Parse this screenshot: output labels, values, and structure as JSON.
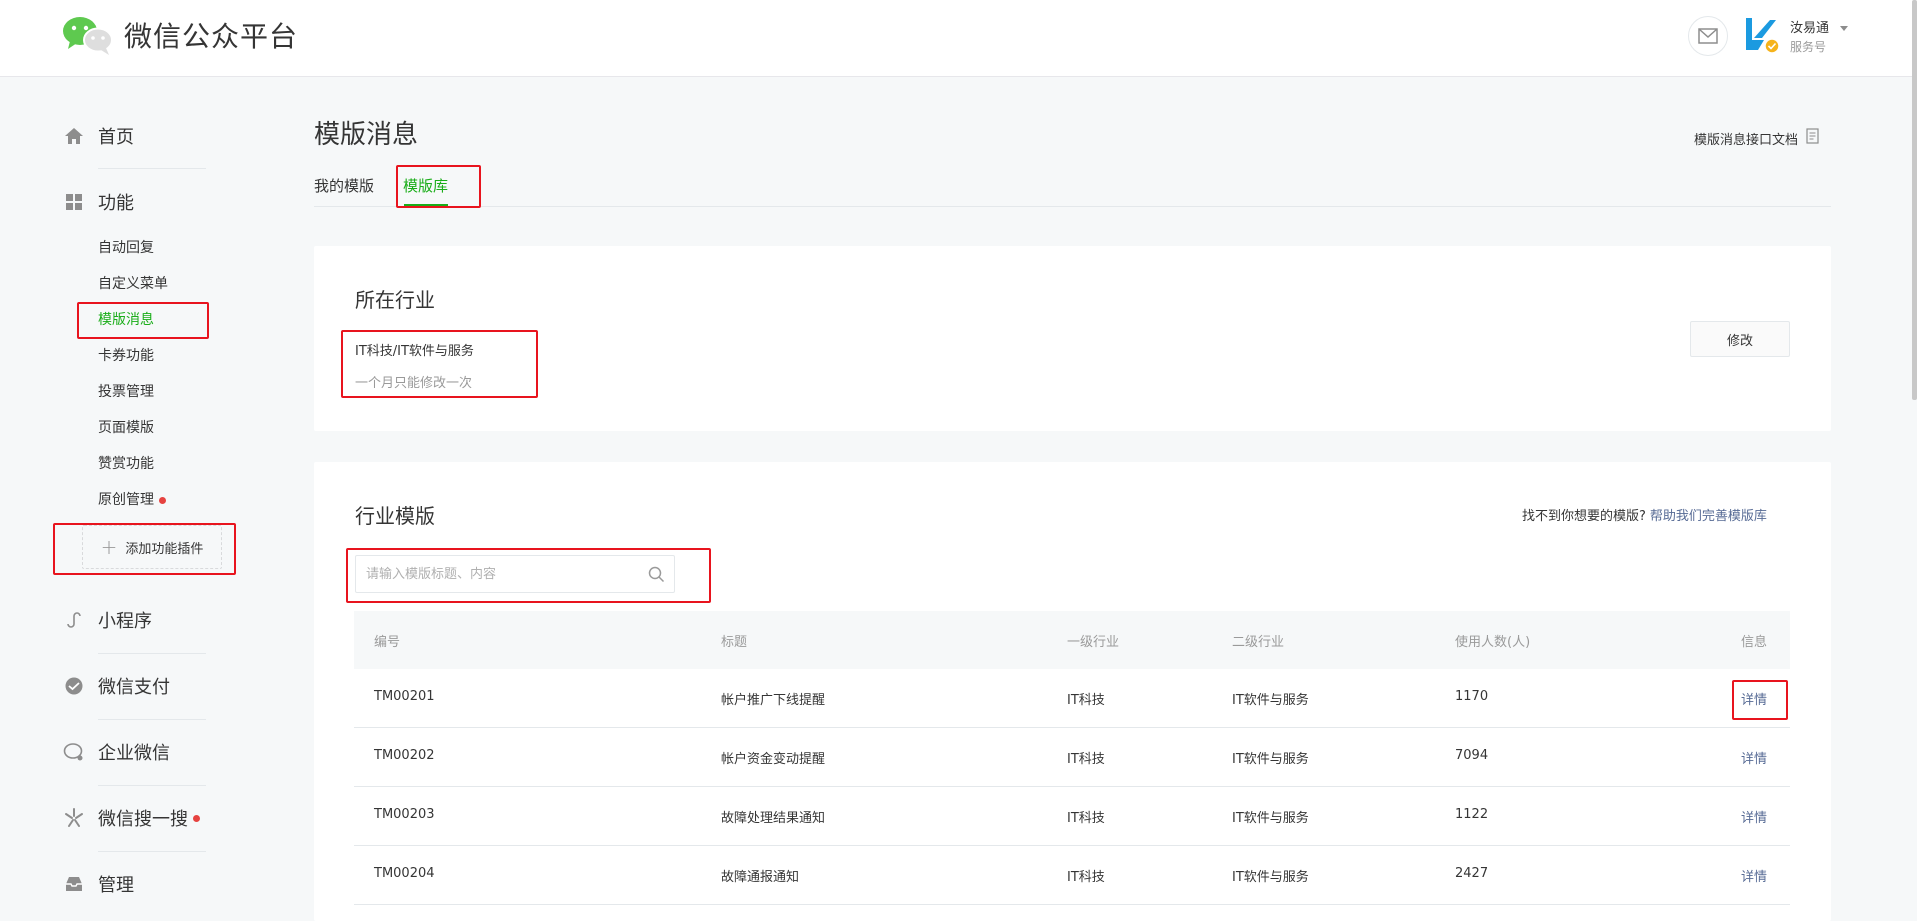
{
  "header": {
    "platform_title": "微信公众平台",
    "account_name": "汝易通",
    "account_type": "服务号",
    "icons": [
      "wechat-logo",
      "mail-icon",
      "account-avatar",
      "chevron-down-icon"
    ]
  },
  "sidebar": {
    "home": "首页",
    "features": "功能",
    "feature_items": [
      {
        "label": "自动回复"
      },
      {
        "label": "自定义菜单"
      },
      {
        "label": "模版消息"
      },
      {
        "label": "卡券功能"
      },
      {
        "label": "投票管理"
      },
      {
        "label": "页面模版"
      },
      {
        "label": "赞赏功能"
      },
      {
        "label": "原创管理"
      }
    ],
    "add_plugin": "添加功能插件",
    "mini_program": "小程序",
    "wechat_pay": "微信支付",
    "enterprise_wechat": "企业微信",
    "wechat_search": "微信搜一搜",
    "manage": "管理"
  },
  "main": {
    "page_title": "模版消息",
    "doc_link": "模版消息接口文档",
    "tabs": [
      {
        "label": "我的模版"
      },
      {
        "label": "模版库"
      }
    ],
    "industry_card": {
      "title": "所在行业",
      "industry": "IT科技/IT软件与服务",
      "note": "一个月只能修改一次",
      "modify_button": "修改"
    },
    "template_card": {
      "title": "行业模版",
      "help_text": "找不到你想要的模版?",
      "help_link": "帮助我们完善模版库",
      "search_placeholder": "请输入模版标题、内容",
      "search_value": "",
      "columns": [
        "编号",
        "标题",
        "一级行业",
        "二级行业",
        "使用人数(人)",
        "信息"
      ],
      "rows": [
        {
          "id": "TM00201",
          "title": "帐户推广下线提醒",
          "industry1": "IT科技",
          "industry2": "IT软件与服务",
          "users": "1170",
          "action": "详情"
        },
        {
          "id": "TM00202",
          "title": "帐户资金变动提醒",
          "industry1": "IT科技",
          "industry2": "IT软件与服务",
          "users": "7094",
          "action": "详情"
        },
        {
          "id": "TM00203",
          "title": "故障处理结果通知",
          "industry1": "IT科技",
          "industry2": "IT软件与服务",
          "users": "1122",
          "action": "详情"
        },
        {
          "id": "TM00204",
          "title": "故障通报通知",
          "industry1": "IT科技",
          "industry2": "IT软件与服务",
          "users": "2427",
          "action": "详情"
        }
      ]
    }
  },
  "colors": {
    "accent_green": "#1aad19",
    "link_blue": "#576b95",
    "highlight_red": "#e8141e"
  }
}
